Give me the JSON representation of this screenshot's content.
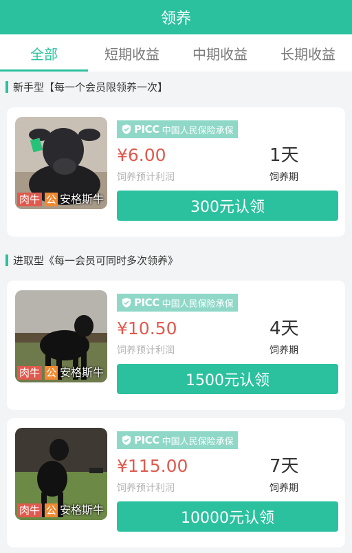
{
  "header": {
    "title": "领养"
  },
  "tabs": [
    {
      "label": "全部"
    },
    {
      "label": "短期收益"
    },
    {
      "label": "中期收益"
    },
    {
      "label": "长期收益"
    }
  ],
  "sections": [
    {
      "title": "新手型【每一个会员限领养一次】"
    },
    {
      "title": "进取型《每一会员可同时多次领养》"
    }
  ],
  "insurance": {
    "brand": "PICC",
    "text": "中国人民保险承保"
  },
  "labels": {
    "profit": "饲养预计利润",
    "period": "饲养期"
  },
  "cards": [
    {
      "tag_meat": "肉牛",
      "tag_gender": "公",
      "breed": "安格斯牛",
      "price": "¥6.00",
      "days": "1天",
      "button": "300元认领"
    },
    {
      "tag_meat": "肉牛",
      "tag_gender": "公",
      "breed": "安格斯牛",
      "price": "¥10.50",
      "days": "4天",
      "button": "1500元认领"
    },
    {
      "tag_meat": "肉牛",
      "tag_gender": "公",
      "breed": "安格斯牛",
      "price": "¥115.00",
      "days": "7天",
      "button": "10000元认领"
    }
  ],
  "colors": {
    "accent": "#2bc19f",
    "price": "#e05a4e",
    "insure_bg": "#8fd8c8"
  }
}
